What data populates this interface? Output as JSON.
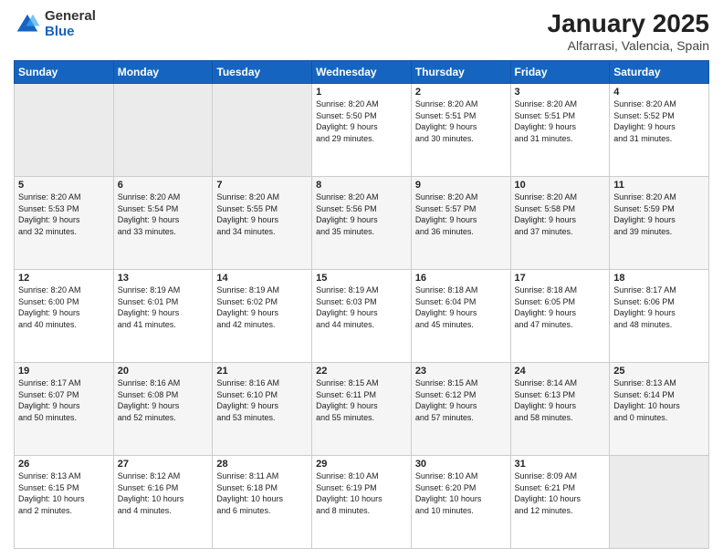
{
  "header": {
    "logo_general": "General",
    "logo_blue": "Blue",
    "title": "January 2025",
    "subtitle": "Alfarrasi, Valencia, Spain"
  },
  "weekdays": [
    "Sunday",
    "Monday",
    "Tuesday",
    "Wednesday",
    "Thursday",
    "Friday",
    "Saturday"
  ],
  "weeks": [
    [
      {
        "day": "",
        "info": ""
      },
      {
        "day": "",
        "info": ""
      },
      {
        "day": "",
        "info": ""
      },
      {
        "day": "1",
        "info": "Sunrise: 8:20 AM\nSunset: 5:50 PM\nDaylight: 9 hours\nand 29 minutes."
      },
      {
        "day": "2",
        "info": "Sunrise: 8:20 AM\nSunset: 5:51 PM\nDaylight: 9 hours\nand 30 minutes."
      },
      {
        "day": "3",
        "info": "Sunrise: 8:20 AM\nSunset: 5:51 PM\nDaylight: 9 hours\nand 31 minutes."
      },
      {
        "day": "4",
        "info": "Sunrise: 8:20 AM\nSunset: 5:52 PM\nDaylight: 9 hours\nand 31 minutes."
      }
    ],
    [
      {
        "day": "5",
        "info": "Sunrise: 8:20 AM\nSunset: 5:53 PM\nDaylight: 9 hours\nand 32 minutes."
      },
      {
        "day": "6",
        "info": "Sunrise: 8:20 AM\nSunset: 5:54 PM\nDaylight: 9 hours\nand 33 minutes."
      },
      {
        "day": "7",
        "info": "Sunrise: 8:20 AM\nSunset: 5:55 PM\nDaylight: 9 hours\nand 34 minutes."
      },
      {
        "day": "8",
        "info": "Sunrise: 8:20 AM\nSunset: 5:56 PM\nDaylight: 9 hours\nand 35 minutes."
      },
      {
        "day": "9",
        "info": "Sunrise: 8:20 AM\nSunset: 5:57 PM\nDaylight: 9 hours\nand 36 minutes."
      },
      {
        "day": "10",
        "info": "Sunrise: 8:20 AM\nSunset: 5:58 PM\nDaylight: 9 hours\nand 37 minutes."
      },
      {
        "day": "11",
        "info": "Sunrise: 8:20 AM\nSunset: 5:59 PM\nDaylight: 9 hours\nand 39 minutes."
      }
    ],
    [
      {
        "day": "12",
        "info": "Sunrise: 8:20 AM\nSunset: 6:00 PM\nDaylight: 9 hours\nand 40 minutes."
      },
      {
        "day": "13",
        "info": "Sunrise: 8:19 AM\nSunset: 6:01 PM\nDaylight: 9 hours\nand 41 minutes."
      },
      {
        "day": "14",
        "info": "Sunrise: 8:19 AM\nSunset: 6:02 PM\nDaylight: 9 hours\nand 42 minutes."
      },
      {
        "day": "15",
        "info": "Sunrise: 8:19 AM\nSunset: 6:03 PM\nDaylight: 9 hours\nand 44 minutes."
      },
      {
        "day": "16",
        "info": "Sunrise: 8:18 AM\nSunset: 6:04 PM\nDaylight: 9 hours\nand 45 minutes."
      },
      {
        "day": "17",
        "info": "Sunrise: 8:18 AM\nSunset: 6:05 PM\nDaylight: 9 hours\nand 47 minutes."
      },
      {
        "day": "18",
        "info": "Sunrise: 8:17 AM\nSunset: 6:06 PM\nDaylight: 9 hours\nand 48 minutes."
      }
    ],
    [
      {
        "day": "19",
        "info": "Sunrise: 8:17 AM\nSunset: 6:07 PM\nDaylight: 9 hours\nand 50 minutes."
      },
      {
        "day": "20",
        "info": "Sunrise: 8:16 AM\nSunset: 6:08 PM\nDaylight: 9 hours\nand 52 minutes."
      },
      {
        "day": "21",
        "info": "Sunrise: 8:16 AM\nSunset: 6:10 PM\nDaylight: 9 hours\nand 53 minutes."
      },
      {
        "day": "22",
        "info": "Sunrise: 8:15 AM\nSunset: 6:11 PM\nDaylight: 9 hours\nand 55 minutes."
      },
      {
        "day": "23",
        "info": "Sunrise: 8:15 AM\nSunset: 6:12 PM\nDaylight: 9 hours\nand 57 minutes."
      },
      {
        "day": "24",
        "info": "Sunrise: 8:14 AM\nSunset: 6:13 PM\nDaylight: 9 hours\nand 58 minutes."
      },
      {
        "day": "25",
        "info": "Sunrise: 8:13 AM\nSunset: 6:14 PM\nDaylight: 10 hours\nand 0 minutes."
      }
    ],
    [
      {
        "day": "26",
        "info": "Sunrise: 8:13 AM\nSunset: 6:15 PM\nDaylight: 10 hours\nand 2 minutes."
      },
      {
        "day": "27",
        "info": "Sunrise: 8:12 AM\nSunset: 6:16 PM\nDaylight: 10 hours\nand 4 minutes."
      },
      {
        "day": "28",
        "info": "Sunrise: 8:11 AM\nSunset: 6:18 PM\nDaylight: 10 hours\nand 6 minutes."
      },
      {
        "day": "29",
        "info": "Sunrise: 8:10 AM\nSunset: 6:19 PM\nDaylight: 10 hours\nand 8 minutes."
      },
      {
        "day": "30",
        "info": "Sunrise: 8:10 AM\nSunset: 6:20 PM\nDaylight: 10 hours\nand 10 minutes."
      },
      {
        "day": "31",
        "info": "Sunrise: 8:09 AM\nSunset: 6:21 PM\nDaylight: 10 hours\nand 12 minutes."
      },
      {
        "day": "",
        "info": ""
      }
    ]
  ]
}
